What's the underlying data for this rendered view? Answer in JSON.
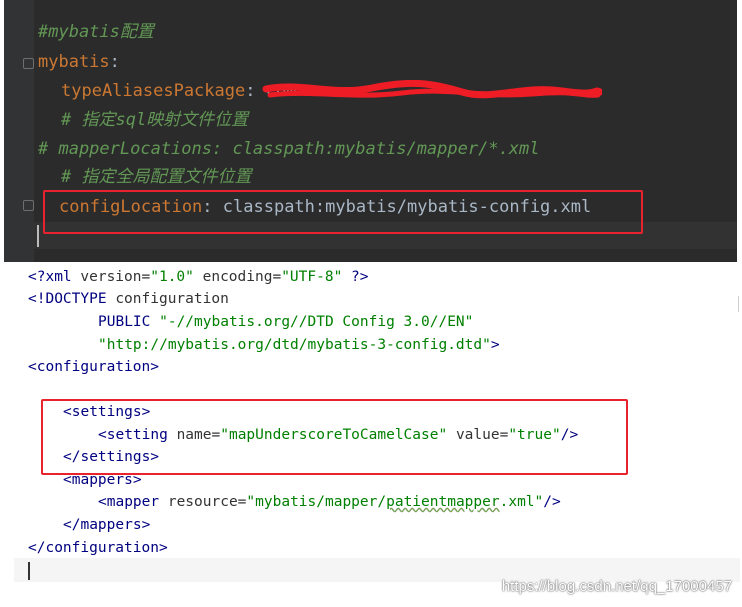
{
  "yaml": {
    "comment_title": "#mybatis配置",
    "root_key": "mybatis",
    "colon": ":",
    "type_aliases_key": "typeAliasesPackage",
    "type_aliases_sep": ": ",
    "type_aliases_value_visible": "com",
    "comment_sql_mapping": "# 指定sql映射文件位置",
    "commented_mapper_locations": "#  mapperLocations: classpath:mybatis/mapper/*.xml",
    "comment_global_config": "# 指定全局配置文件位置",
    "config_location_key": "configLocation",
    "config_location_sep": ": ",
    "config_location_value": "classpath:mybatis/mybatis-config.xml"
  },
  "xml": {
    "decl_open": "<?xml ",
    "decl_version_attr": "version=",
    "decl_version_val": "\"1.0\"",
    "decl_encoding_attr": " encoding=",
    "decl_encoding_val": "\"UTF-8\"",
    "decl_close": " ?>",
    "doctype_open": "<!DOCTYPE ",
    "doctype_name": "configuration",
    "doctype_public_kw": "PUBLIC ",
    "doctype_public_id": "\"-//mybatis.org//DTD Config 3.0//EN\"",
    "doctype_system_id": "\"http://mybatis.org/dtd/mybatis-3-config.dtd\"",
    "doctype_close": ">",
    "configuration_open": "<configuration>",
    "settings_open": "<settings>",
    "setting_tag": "<setting ",
    "setting_name_attr": "name=",
    "setting_name_val": "\"mapUnderscoreToCamelCase\"",
    "setting_value_attr": " value=",
    "setting_value_val": "\"true\"",
    "setting_close": "/>",
    "settings_close": "</settings>",
    "mappers_open": "<mappers>",
    "mapper_tag": "<mapper ",
    "mapper_resource_attr": "resource=",
    "mapper_resource_val_a": "\"mybatis/mapper/",
    "mapper_resource_val_b": "patientmapper",
    "mapper_resource_val_c": ".xml\"",
    "mapper_close": "/>",
    "mappers_close": "</mappers>",
    "configuration_close": "</configuration>"
  },
  "watermark": "https://blog.csdn.net/qq_17000457",
  "colors": {
    "yaml_bg": "#2b2b2b",
    "yaml_key": "#cc7832",
    "yaml_comment": "#629755",
    "xml_tag": "#000080",
    "xml_string": "#008000",
    "highlight_box": "#e8232e"
  }
}
